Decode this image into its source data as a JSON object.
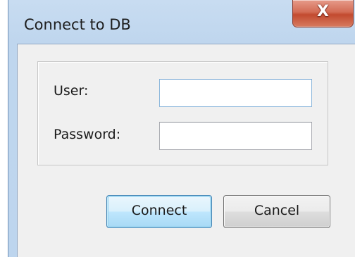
{
  "window": {
    "title": "Connect to DB",
    "close_glyph": "X"
  },
  "form": {
    "user_label": "User:",
    "user_value": "",
    "password_label": "Password:",
    "password_value": ""
  },
  "buttons": {
    "connect_label": "Connect",
    "cancel_label": "Cancel"
  },
  "colors": {
    "title_bar": "#c8dcf1",
    "close_button": "#c24a2f",
    "client_area": "#f0f0f0",
    "default_button": "#bee6fd"
  }
}
